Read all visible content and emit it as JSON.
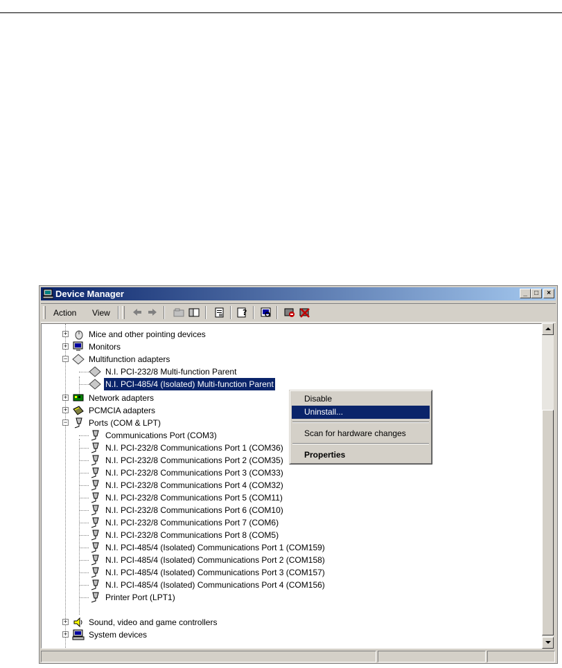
{
  "window": {
    "title": "Device Manager"
  },
  "menu": {
    "action": "Action",
    "view": "View"
  },
  "tree": {
    "mice": "Mice and other pointing devices",
    "monitors": "Monitors",
    "multifunction": "Multifunction adapters",
    "mf_child_1": "N.I. PCI-232/8 Multi-function Parent",
    "mf_child_2": "N.I. PCI-485/4 (Isolated) Multi-function Parent",
    "network": "Network adapters",
    "pcmcia": "PCMCIA adapters",
    "ports": "Ports (COM & LPT)",
    "port_items": [
      "Communications Port (COM3)",
      "N.I. PCI-232/8 Communications Port 1 (COM36)",
      "N.I. PCI-232/8 Communications Port 2 (COM35)",
      "N.I. PCI-232/8 Communications Port 3 (COM33)",
      "N.I. PCI-232/8 Communications Port 4 (COM32)",
      "N.I. PCI-232/8 Communications Port 5 (COM11)",
      "N.I. PCI-232/8 Communications Port 6 (COM10)",
      "N.I. PCI-232/8 Communications Port 7 (COM6)",
      "N.I. PCI-232/8 Communications Port 8 (COM5)",
      "N.I. PCI-485/4 (Isolated) Communications Port 1 (COM159)",
      "N.I. PCI-485/4 (Isolated) Communications Port 2 (COM158)",
      "N.I. PCI-485/4 (Isolated) Communications Port 3 (COM157)",
      "N.I. PCI-485/4 (Isolated) Communications Port 4 (COM156)",
      "Printer Port (LPT1)"
    ],
    "sound": "Sound, video and game controllers",
    "system": "System devices"
  },
  "context_menu": {
    "disable": "Disable",
    "uninstall": "Uninstall...",
    "scan": "Scan for hardware changes",
    "properties": "Properties"
  },
  "titlebar_buttons": {
    "minimize": "_",
    "maximize": "□",
    "close": "×"
  },
  "colors": {
    "title_start": "#0a246a",
    "title_end": "#a6caf0",
    "selection": "#0a246a",
    "chrome": "#d4d0c8"
  }
}
